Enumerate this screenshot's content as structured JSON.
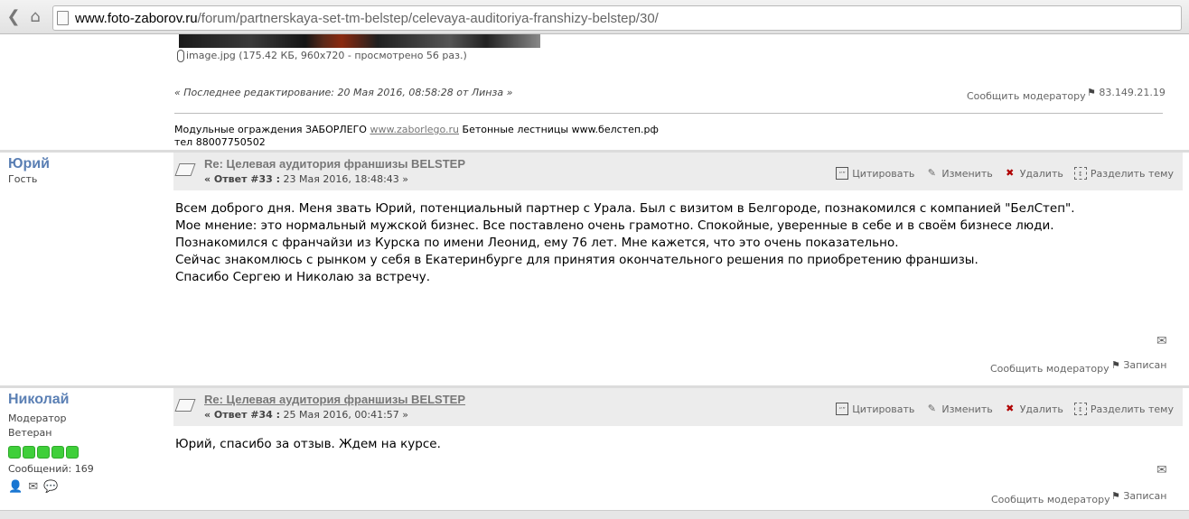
{
  "browser": {
    "url_host": "www.foto-zaborov.ru",
    "url_path": "/forum/partnerskaya-set-tm-belstep/celevaya-auditoriya-franshizy-belstep/30/",
    "back_icon": "chevron-left-icon",
    "home_icon": "home-icon"
  },
  "prev_post": {
    "attachment": "image.jpg (175.42 КБ, 960x720 - просмотрено 56 раз.)",
    "edit_note": "« Последнее редактирование: 20 Мая 2016, 08:58:28 от Линза »",
    "report": "Сообщить модератору",
    "ip": "83.149.21.19",
    "signature_line1_prefix": "Модульные ограждения ЗАБОРЛЕГО ",
    "signature_link": "www.zaborlego.ru",
    "signature_line1_suffix": " Бетонные лестницы www.белстеп.рф",
    "signature_line2": "тел 88007750502"
  },
  "posts": [
    {
      "author": "Юрий",
      "role": "Гость",
      "title": "Re: Целевая аудитория франшизы BELSTEP",
      "reply_label": "« Ответ #33 :",
      "date": "23 Мая 2016, 18:48:43 »",
      "actions": {
        "quote": "Цитировать",
        "edit": "Изменить",
        "delete": "Удалить",
        "split": "Разделить тему"
      },
      "body": [
        "Всем доброго дня. Меня звать Юрий, потенциальный партнер с Урала. Был с визитом в Белгороде, познакомился с компанией \"БелСтеп\".",
        "Мое мнение: это нормальный мужской бизнес. Все поставлено очень грамотно. Спокойные, уверенные в себе и в своём бизнесе люди.",
        "Познакомился с франчайзи из Курска по имени Леонид, ему 76 лет. Мне кажется, что это очень показательно.",
        "Сейчас знакомлюсь  с рынком у себя в Екатеринбурге для принятия окончательного решения по приобретению франшизы.",
        "Спасибо Сергею и Николаю за встречу."
      ],
      "report": "Сообщить модератору",
      "logged": "Записан"
    },
    {
      "author": "Николай",
      "role": "Модератор",
      "rank": "Ветеран",
      "stars": 5,
      "messages": "Сообщений: 169",
      "title": "Re: Целевая аудитория франшизы BELSTEP",
      "reply_label": "« Ответ #34 :",
      "date": "25 Мая 2016, 00:41:57 »",
      "actions": {
        "quote": "Цитировать",
        "edit": "Изменить",
        "delete": "Удалить",
        "split": "Разделить тему"
      },
      "body": [
        "Юрий, спасибо за отзыв. Ждем на курсе."
      ],
      "report": "Сообщить модератору",
      "logged": "Записан"
    }
  ],
  "colors": {
    "author": "#5a7fb4",
    "header_bg": "#ececec",
    "star": "#3fcf3a"
  }
}
